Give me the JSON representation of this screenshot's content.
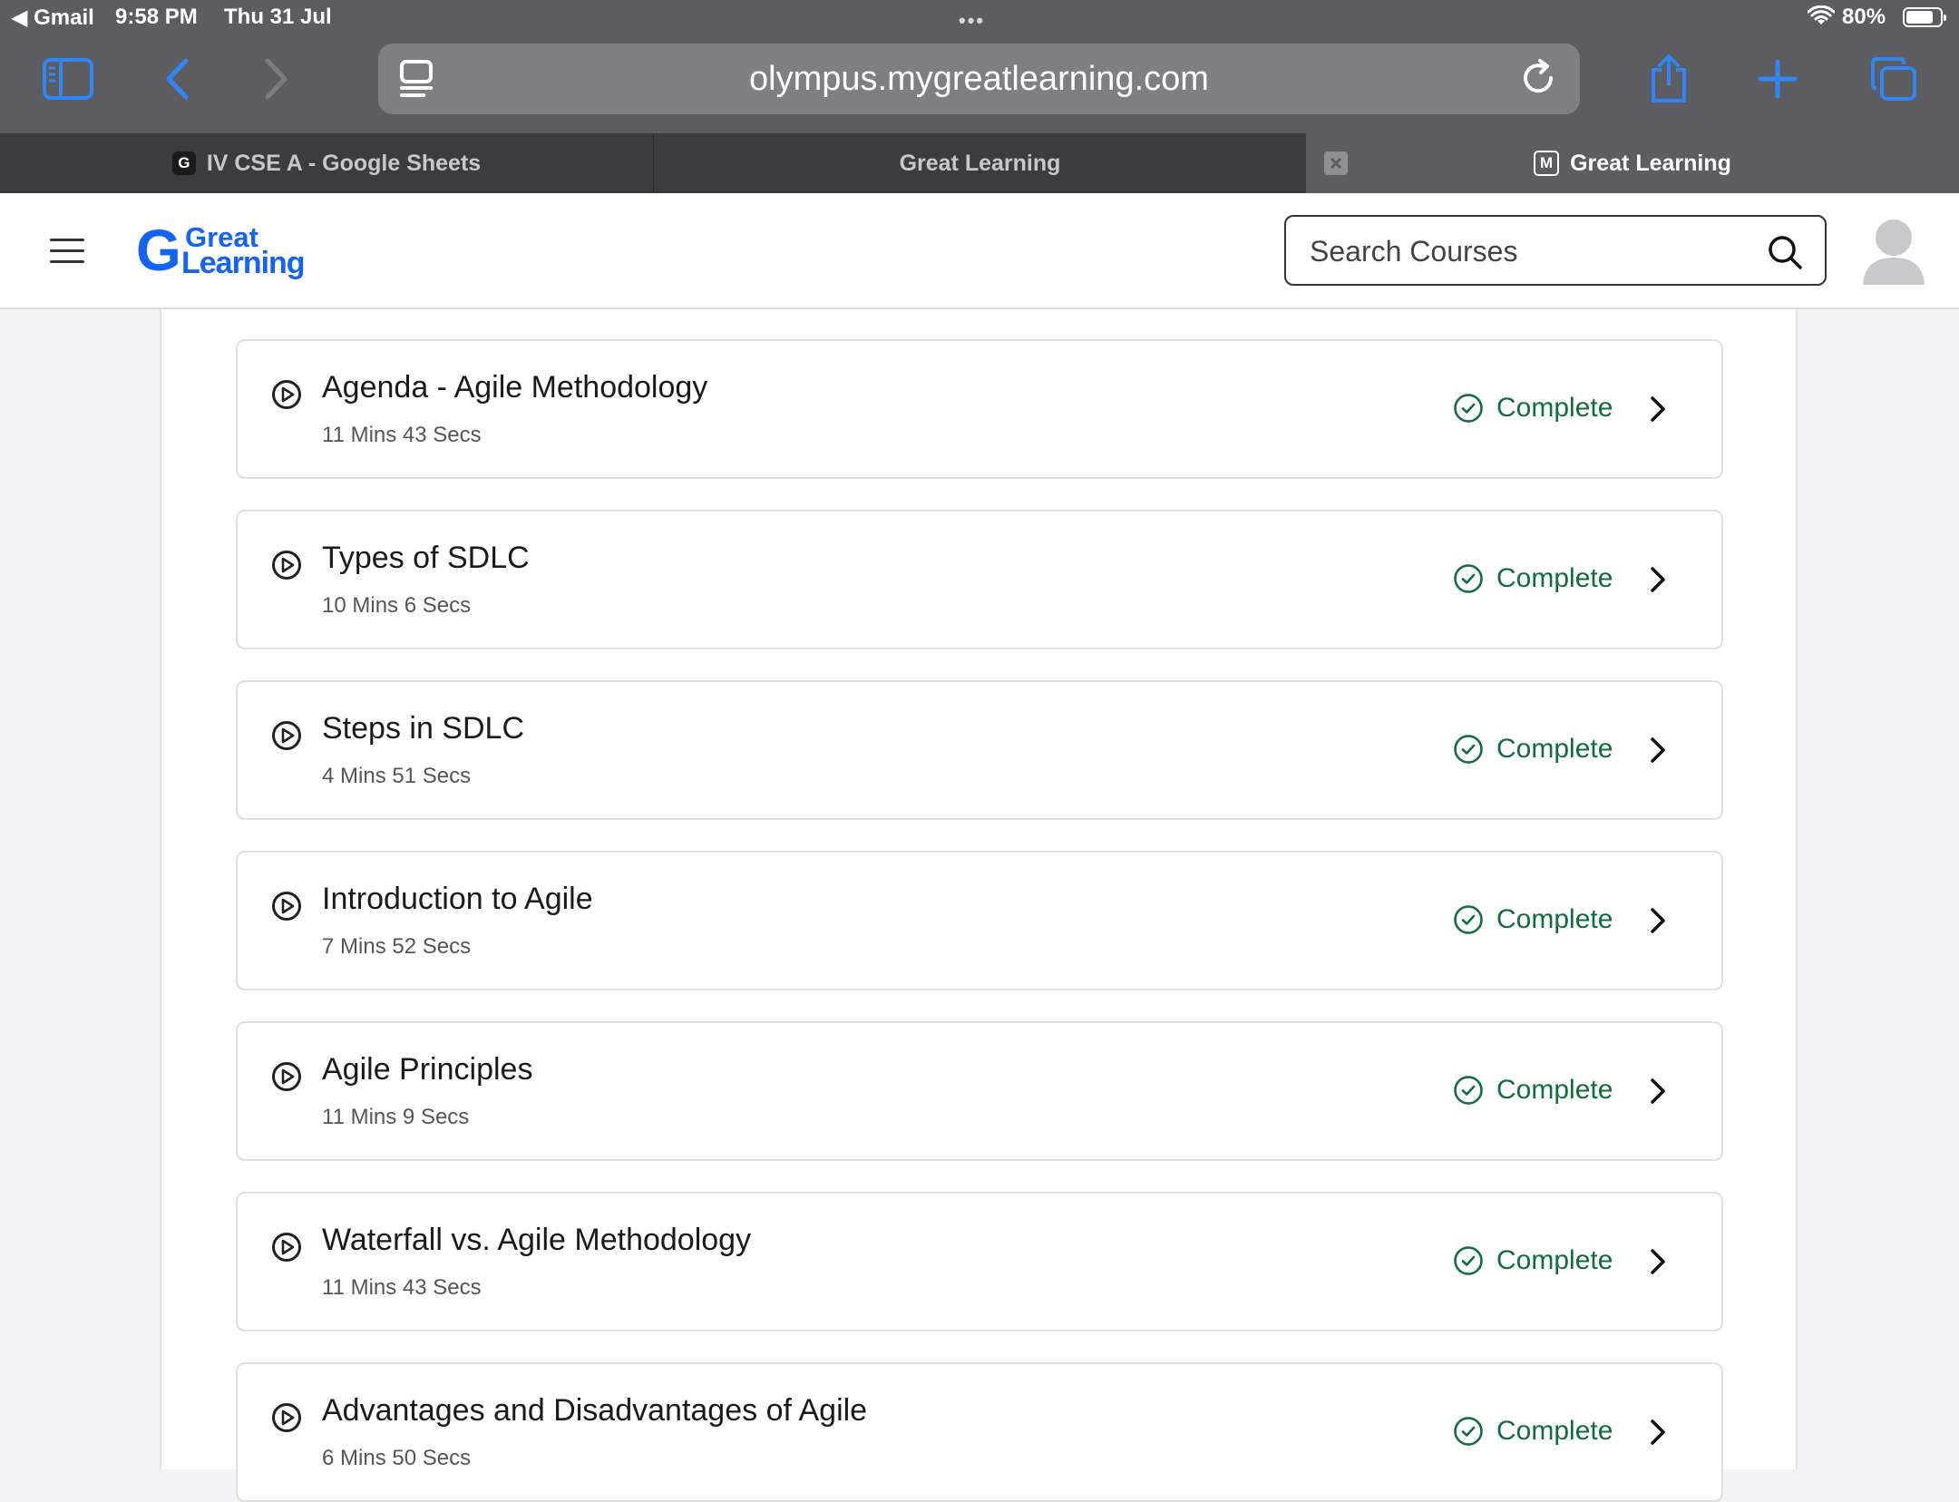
{
  "status_bar": {
    "back_app": "◀ Gmail",
    "time": "9:58 PM",
    "date": "Thu 31 Jul",
    "battery": "80%",
    "battery_level": 0.8
  },
  "browser": {
    "url": "olympus.mygreatlearning.com",
    "tabs": [
      {
        "favicon": "G",
        "title": "IV CSE A - Google Sheets",
        "active": false
      },
      {
        "favicon": "",
        "title": "Great Learning",
        "active": false
      },
      {
        "favicon": "M",
        "title": "Great Learning",
        "active": true
      }
    ]
  },
  "header": {
    "logo_mark": "G",
    "logo_line1": "Great",
    "logo_line2": "Learning",
    "search_placeholder": "Search Courses"
  },
  "colors": {
    "brand": "#1463f3",
    "complete_green": "#0f6e3a",
    "safari_blue": "#2f86f6"
  },
  "lessons": [
    {
      "title": "Agenda - Agile Methodology",
      "duration": "11 Mins 43 Secs",
      "status": "Complete"
    },
    {
      "title": "Types of SDLC",
      "duration": "10 Mins 6 Secs",
      "status": "Complete"
    },
    {
      "title": "Steps in SDLC",
      "duration": "4 Mins 51 Secs",
      "status": "Complete"
    },
    {
      "title": "Introduction to Agile",
      "duration": "7 Mins 52 Secs",
      "status": "Complete"
    },
    {
      "title": "Agile Principles",
      "duration": "11 Mins 9 Secs",
      "status": "Complete"
    },
    {
      "title": "Waterfall vs. Agile Methodology",
      "duration": "11 Mins 43 Secs",
      "status": "Complete"
    },
    {
      "title": "Advantages and Disadvantages of Agile",
      "duration": "6 Mins 50 Secs",
      "status": "Complete"
    }
  ]
}
